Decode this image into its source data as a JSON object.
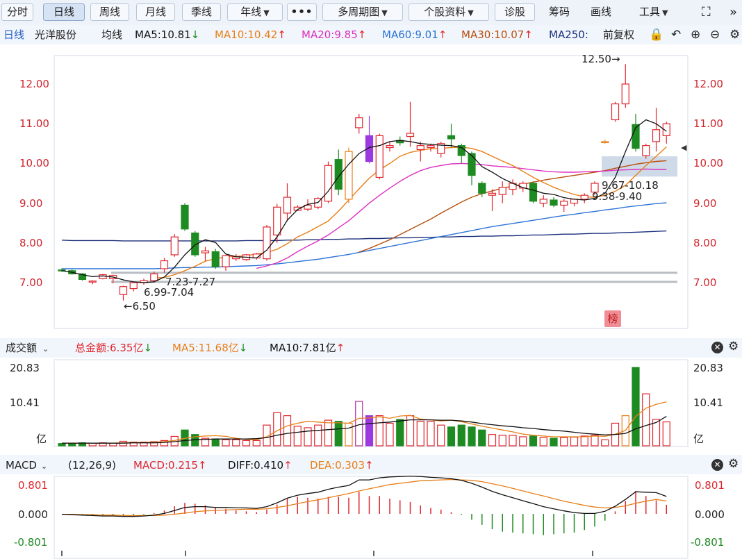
{
  "toolbar": {
    "tabs": [
      "分时",
      "日线",
      "周线",
      "月线",
      "季线",
      "年线"
    ],
    "more": "•••",
    "multi_period": "多周期图",
    "stock_info": "个股资料",
    "diagnose": "诊股",
    "chips": "筹码",
    "draw": "画线",
    "tools": "工具"
  },
  "info": {
    "period": "日线",
    "stock_name": "光洋股份",
    "avg_line": "均线",
    "ma5": "MA5:10.81",
    "ma10": "MA10:10.42",
    "ma20": "MA20:9.85",
    "ma60": "MA60:9.01",
    "ma30": "MA30:10.07",
    "ma250": "MA250:",
    "adjust": "前复权"
  },
  "price_panel": {
    "y_ticks": [
      "12.00",
      "11.00",
      "10.00",
      "9.00",
      "8.00",
      "7.00"
    ],
    "high_label": "12.50→",
    "low_label": "←6.50",
    "zone_labels": [
      "7.23-7.27",
      "6.99-7.04",
      "9.67-10.18",
      "9.38-9.40"
    ],
    "badge": "榜"
  },
  "volume_panel": {
    "title": "成交额",
    "total": "总金额:6.35亿",
    "ma5": "MA5:11.68亿",
    "ma10": "MA10:7.81亿",
    "y_ticks": [
      "20.83",
      "10.41",
      "亿"
    ]
  },
  "macd_panel": {
    "title": "MACD",
    "params": "(12,26,9)",
    "macd": "MACD:0.215",
    "diff": "DIFF:0.410",
    "dea": "DEA:0.303",
    "y_ticks": [
      "0.801",
      "0.000",
      "-0.801"
    ]
  },
  "colors": {
    "up": "#e0262d",
    "down": "#1e8a22",
    "ma5": "#111111",
    "ma10": "#e87e17",
    "ma20": "#dd2fc0",
    "ma30": "#b84d0c",
    "ma60": "#2c73d6",
    "ma250": "#1a2f7a",
    "highlight": "#9a39e0"
  },
  "chart_data": {
    "type": "candlestick",
    "x_count": 60,
    "price_ylim": [
      6.0,
      12.8
    ],
    "candles": [
      [
        7.32,
        7.36,
        7.27,
        7.3
      ],
      [
        7.3,
        7.33,
        7.2,
        7.22
      ],
      [
        7.22,
        7.24,
        7.05,
        7.08
      ],
      [
        7.02,
        7.06,
        6.96,
        7.04
      ],
      [
        7.1,
        7.22,
        7.08,
        7.2
      ],
      [
        7.1,
        7.2,
        6.98,
        7.18
      ],
      [
        6.7,
        6.92,
        6.55,
        6.9
      ],
      [
        6.85,
        7.02,
        6.78,
        7.0
      ],
      [
        7.0,
        7.1,
        6.95,
        7.05
      ],
      [
        7.05,
        7.28,
        7.0,
        7.22
      ],
      [
        7.35,
        7.62,
        7.25,
        7.55
      ],
      [
        7.7,
        8.22,
        7.65,
        8.15
      ],
      [
        8.95,
        9.0,
        8.3,
        8.35
      ],
      [
        8.25,
        8.3,
        7.65,
        7.7
      ],
      [
        7.75,
        7.9,
        7.55,
        7.8
      ],
      [
        7.78,
        7.85,
        7.35,
        7.4
      ],
      [
        7.4,
        7.7,
        7.3,
        7.68
      ],
      [
        7.6,
        7.72,
        7.55,
        7.65
      ],
      [
        7.58,
        7.72,
        7.55,
        7.7
      ],
      [
        7.62,
        7.75,
        7.58,
        7.72
      ],
      [
        7.6,
        8.45,
        7.55,
        8.4
      ],
      [
        8.2,
        8.98,
        8.0,
        8.9
      ],
      [
        8.75,
        9.5,
        8.55,
        9.15
      ],
      [
        8.82,
        8.95,
        8.8,
        8.9
      ],
      [
        8.85,
        9.1,
        8.8,
        8.95
      ],
      [
        8.9,
        9.15,
        8.85,
        9.12
      ],
      [
        9.05,
        10.05,
        9.0,
        9.95
      ],
      [
        10.1,
        10.35,
        9.2,
        9.35
      ],
      [
        9.1,
        10.4,
        9.0,
        10.3
      ],
      [
        10.9,
        11.25,
        10.75,
        11.15
      ],
      [
        10.7,
        11.2,
        10.0,
        10.05
      ],
      [
        9.65,
        10.75,
        9.6,
        10.7
      ],
      [
        10.4,
        10.55,
        10.3,
        10.45
      ],
      [
        10.58,
        10.68,
        10.45,
        10.52
      ],
      [
        10.68,
        11.55,
        10.42,
        10.76
      ],
      [
        10.35,
        10.55,
        10.05,
        10.45
      ],
      [
        10.4,
        10.5,
        10.3,
        10.45
      ],
      [
        10.25,
        10.55,
        10.15,
        10.5
      ],
      [
        10.7,
        11.0,
        10.4,
        10.62
      ],
      [
        10.45,
        10.5,
        10.0,
        10.2
      ],
      [
        10.25,
        10.3,
        9.45,
        9.7
      ],
      [
        9.5,
        9.55,
        9.15,
        9.25
      ],
      [
        9.2,
        9.35,
        8.8,
        9.25
      ],
      [
        9.22,
        9.55,
        9.0,
        9.4
      ],
      [
        9.35,
        9.6,
        9.2,
        9.5
      ],
      [
        9.38,
        9.55,
        9.28,
        9.5
      ],
      [
        9.5,
        9.55,
        9.0,
        9.05
      ],
      [
        9.0,
        9.2,
        8.9,
        9.1
      ],
      [
        9.08,
        9.15,
        8.9,
        8.95
      ],
      [
        8.95,
        9.1,
        8.78,
        9.05
      ],
      [
        9.0,
        9.12,
        8.92,
        9.1
      ],
      [
        9.1,
        9.25,
        9.0,
        9.2
      ],
      [
        9.28,
        9.55,
        9.2,
        9.5
      ],
      [
        10.55,
        10.6,
        10.5,
        10.55
      ],
      [
        11.1,
        11.55,
        11.05,
        11.5
      ],
      [
        11.5,
        12.5,
        11.4,
        12.0
      ],
      [
        10.98,
        11.25,
        10.3,
        10.38
      ],
      [
        10.2,
        10.5,
        10.12,
        10.45
      ],
      [
        10.55,
        11.4,
        10.3,
        10.85
      ],
      [
        10.7,
        11.05,
        10.5,
        11.0
      ]
    ],
    "ma5": [
      7.3,
      7.26,
      7.2,
      7.15,
      7.17,
      7.14,
      7.07,
      7.02,
      7.0,
      7.02,
      7.14,
      7.39,
      7.7,
      7.95,
      8.08,
      8.01,
      7.72,
      7.65,
      7.64,
      7.62,
      7.82,
      8.15,
      8.57,
      8.84,
      8.97,
      9.02,
      9.3,
      9.67,
      9.98,
      10.25,
      10.4,
      10.45,
      10.55,
      10.58,
      10.55,
      10.5,
      10.48,
      10.46,
      10.45,
      10.4,
      10.2,
      9.92,
      9.78,
      9.62,
      9.5,
      9.39,
      9.33,
      9.25,
      9.22,
      9.14,
      9.1,
      9.08,
      9.12,
      9.25,
      9.65,
      10.3,
      10.9,
      11.1,
      11.0,
      10.81
    ],
    "ma10": [
      null,
      null,
      null,
      null,
      null,
      null,
      null,
      null,
      null,
      7.12,
      7.13,
      7.2,
      7.3,
      7.41,
      7.54,
      7.6,
      7.65,
      7.66,
      7.68,
      7.72,
      7.76,
      7.84,
      7.98,
      8.15,
      8.27,
      8.41,
      8.55,
      8.8,
      9.08,
      9.36,
      9.63,
      9.84,
      10.0,
      10.18,
      10.28,
      10.33,
      10.37,
      10.38,
      10.4,
      10.41,
      10.38,
      10.3,
      10.18,
      10.06,
      9.95,
      9.8,
      9.65,
      9.52,
      9.4,
      9.3,
      9.22,
      9.16,
      9.15,
      9.2,
      9.3,
      9.45,
      9.7,
      9.95,
      10.18,
      10.42
    ],
    "ma20": [
      null,
      null,
      null,
      null,
      null,
      null,
      null,
      null,
      null,
      null,
      null,
      null,
      null,
      null,
      null,
      null,
      null,
      null,
      null,
      7.36,
      7.42,
      7.5,
      7.62,
      7.78,
      7.92,
      8.05,
      8.2,
      8.38,
      8.56,
      8.78,
      9.0,
      9.2,
      9.38,
      9.55,
      9.7,
      9.82,
      9.9,
      9.95,
      9.99,
      10.0,
      9.99,
      9.97,
      9.94,
      9.92,
      9.9,
      9.87,
      9.84,
      9.81,
      9.79,
      9.78,
      9.78,
      9.79,
      9.8,
      9.81,
      9.83,
      9.84,
      9.85,
      9.86,
      9.85,
      9.85
    ],
    "ma30": [
      null,
      null,
      null,
      null,
      null,
      null,
      null,
      null,
      null,
      null,
      null,
      null,
      null,
      null,
      null,
      null,
      null,
      null,
      null,
      null,
      null,
      null,
      null,
      null,
      null,
      null,
      null,
      null,
      null,
      7.77,
      7.86,
      7.97,
      8.08,
      8.21,
      8.34,
      8.47,
      8.6,
      8.75,
      8.89,
      9.03,
      9.15,
      9.24,
      9.31,
      9.38,
      9.43,
      9.48,
      9.53,
      9.58,
      9.62,
      9.66,
      9.7,
      9.74,
      9.78,
      9.82,
      9.88,
      9.93,
      9.98,
      10.02,
      10.05,
      10.07
    ],
    "ma60": [
      7.35,
      7.35,
      7.35,
      7.35,
      7.35,
      7.35,
      7.35,
      7.35,
      7.35,
      7.35,
      7.36,
      7.37,
      7.38,
      7.38,
      7.39,
      7.39,
      7.4,
      7.41,
      7.42,
      7.43,
      7.45,
      7.47,
      7.5,
      7.53,
      7.56,
      7.59,
      7.63,
      7.67,
      7.71,
      7.76,
      7.81,
      7.86,
      7.91,
      7.96,
      8.01,
      8.06,
      8.11,
      8.16,
      8.21,
      8.26,
      8.31,
      8.36,
      8.41,
      8.45,
      8.49,
      8.53,
      8.57,
      8.61,
      8.65,
      8.69,
      8.72,
      8.76,
      8.79,
      8.83,
      8.86,
      8.9,
      8.93,
      8.96,
      8.99,
      9.01
    ],
    "ma250": [
      8.07,
      8.06,
      8.06,
      8.06,
      8.06,
      8.06,
      8.05,
      8.05,
      8.05,
      8.05,
      8.05,
      8.05,
      8.05,
      8.05,
      8.05,
      8.05,
      8.05,
      8.05,
      8.06,
      8.06,
      8.06,
      8.06,
      8.07,
      8.07,
      8.08,
      8.08,
      8.09,
      8.09,
      8.1,
      8.1,
      8.11,
      8.11,
      8.12,
      8.13,
      8.13,
      8.14,
      8.14,
      8.15,
      8.15,
      8.16,
      8.16,
      8.17,
      8.17,
      8.18,
      8.18,
      8.19,
      8.2,
      8.2,
      8.21,
      8.22,
      8.22,
      8.23,
      8.24,
      8.24,
      8.25,
      8.26,
      8.27,
      8.28,
      8.29,
      8.3
    ],
    "support_levels": [
      7.25,
      7.02
    ],
    "resistance_zone": [
      9.67,
      10.18
    ],
    "volume": [
      0.6,
      0.7,
      0.8,
      0.7,
      0.8,
      0.7,
      1.2,
      1.0,
      1.0,
      1.1,
      1.4,
      2.5,
      4.2,
      3.0,
      2.0,
      1.8,
      1.6,
      1.6,
      1.4,
      1.4,
      5.5,
      8.8,
      8.0,
      5.2,
      4.8,
      5.5,
      6.8,
      6.5,
      6.0,
      11.8,
      8.0,
      8.0,
      6.0,
      7.0,
      8.0,
      6.5,
      6.5,
      5.5,
      5.0,
      5.5,
      5.0,
      4.2,
      3.0,
      2.8,
      2.8,
      2.4,
      2.6,
      2.2,
      2.0,
      2.2,
      2.3,
      2.6,
      2.8,
      1.6,
      6.0,
      8.0,
      20.8,
      13.8,
      7.0,
      6.35
    ],
    "volume_ma5": [
      0.7,
      0.7,
      0.7,
      0.7,
      0.7,
      0.7,
      0.8,
      0.9,
      0.9,
      1.0,
      1.1,
      1.4,
      2.0,
      2.4,
      2.6,
      2.7,
      2.5,
      2.0,
      1.7,
      1.6,
      2.4,
      4.0,
      5.3,
      6.0,
      6.5,
      6.3,
      6.1,
      6.1,
      6.0,
      7.3,
      7.4,
      7.7,
      7.3,
      7.9,
      8.1,
      7.1,
      6.9,
      6.6,
      6.8,
      6.4,
      5.8,
      5.2,
      4.7,
      4.2,
      3.7,
      3.1,
      2.8,
      2.6,
      2.4,
      2.4,
      2.4,
      2.4,
      2.6,
      2.5,
      3.1,
      4.1,
      7.8,
      10.0,
      11.0,
      11.68
    ],
    "volume_ma10": [
      0.7,
      0.7,
      0.7,
      0.7,
      0.7,
      0.7,
      0.7,
      0.8,
      0.8,
      0.8,
      0.9,
      1.1,
      1.4,
      1.6,
      1.7,
      1.8,
      1.8,
      1.8,
      1.8,
      1.9,
      2.2,
      2.8,
      3.3,
      3.6,
      3.9,
      4.1,
      4.3,
      4.5,
      4.7,
      5.6,
      5.9,
      6.1,
      6.3,
      6.6,
      6.9,
      6.9,
      6.9,
      6.8,
      6.8,
      6.6,
      6.3,
      5.9,
      5.6,
      5.3,
      5.1,
      4.8,
      4.6,
      4.3,
      4.1,
      3.9,
      3.6,
      3.3,
      3.1,
      2.9,
      3.0,
      3.3,
      4.5,
      5.4,
      6.2,
      7.81
    ],
    "volume_ylim": [
      0,
      20.83
    ],
    "macd_dif": [
      -0.01,
      -0.02,
      -0.03,
      -0.04,
      -0.05,
      -0.05,
      -0.06,
      -0.06,
      -0.05,
      -0.03,
      0.01,
      0.08,
      0.15,
      0.17,
      0.17,
      0.15,
      0.15,
      0.14,
      0.14,
      0.13,
      0.17,
      0.26,
      0.37,
      0.44,
      0.48,
      0.51,
      0.58,
      0.63,
      0.67,
      0.8,
      0.8,
      0.85,
      0.87,
      0.88,
      0.89,
      0.88,
      0.86,
      0.85,
      0.83,
      0.79,
      0.72,
      0.63,
      0.53,
      0.45,
      0.38,
      0.31,
      0.24,
      0.17,
      0.12,
      0.07,
      0.03,
      0.01,
      0.01,
      0.06,
      0.18,
      0.34,
      0.52,
      0.51,
      0.5,
      0.41
    ],
    "macd_dea": [
      -0.01,
      -0.01,
      -0.02,
      -0.02,
      -0.03,
      -0.03,
      -0.04,
      -0.04,
      -0.04,
      -0.04,
      -0.03,
      -0.01,
      0.02,
      0.05,
      0.07,
      0.08,
      0.09,
      0.1,
      0.11,
      0.11,
      0.12,
      0.15,
      0.19,
      0.24,
      0.29,
      0.33,
      0.38,
      0.43,
      0.48,
      0.54,
      0.59,
      0.64,
      0.69,
      0.72,
      0.75,
      0.78,
      0.79,
      0.8,
      0.81,
      0.8,
      0.79,
      0.76,
      0.71,
      0.66,
      0.6,
      0.54,
      0.48,
      0.42,
      0.36,
      0.3,
      0.25,
      0.2,
      0.16,
      0.14,
      0.15,
      0.19,
      0.25,
      0.3,
      0.34,
      0.303
    ],
    "macd_ylim": [
      -0.9,
      0.9
    ]
  }
}
